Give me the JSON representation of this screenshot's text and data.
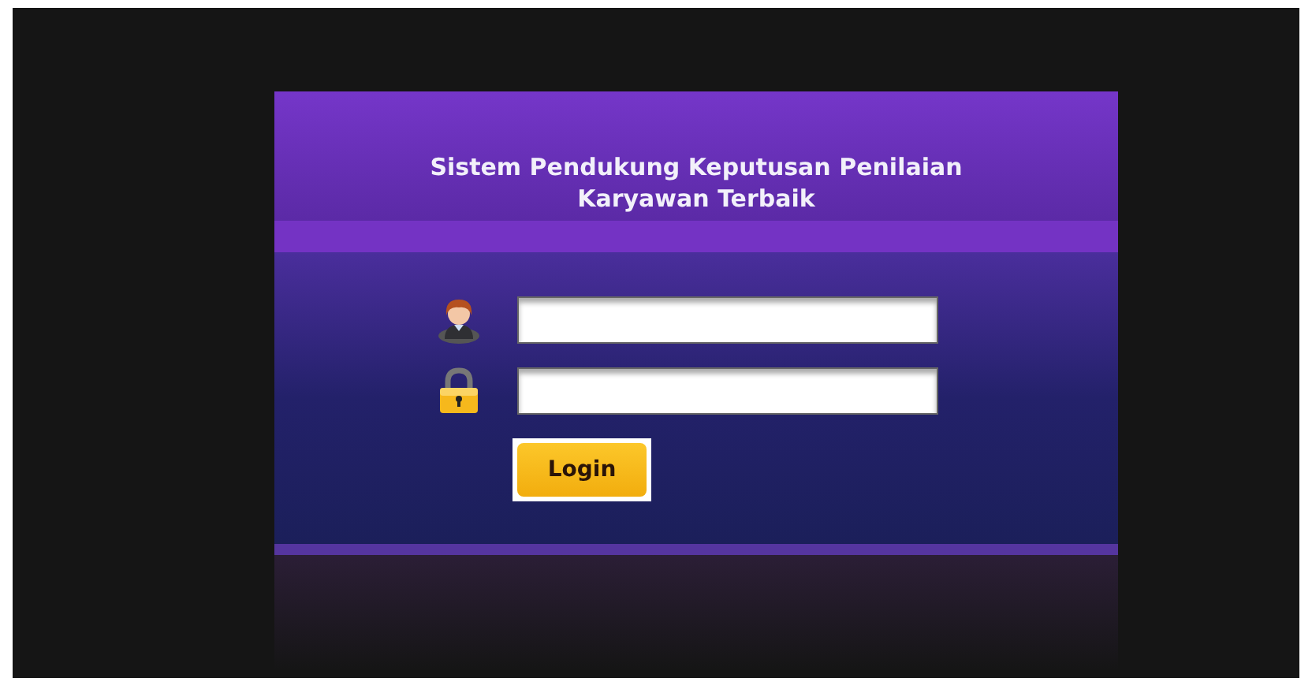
{
  "title": "Sistem Pendukung Keputusan Penilaian Karyawan Terbaik",
  "fields": [
    {
      "kind": "user"
    },
    {
      "kind": "password"
    }
  ],
  "button": {
    "label": "Login"
  }
}
